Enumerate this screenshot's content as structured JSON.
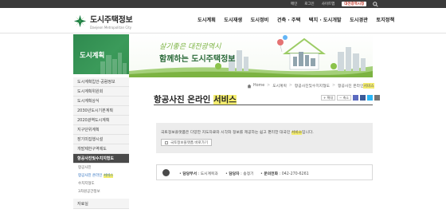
{
  "util": {
    "home": "메인",
    "login": "로그인",
    "sitemap": "사이트맵",
    "lang": "대전광역시청"
  },
  "logo": {
    "title": "도시주택정보",
    "subtitle": "Daejeon Metropolitan City"
  },
  "gnb": [
    "도시계획",
    "도시재생",
    "도시정비",
    "건축 · 주택",
    "택지 · 도시개발",
    "도시경관",
    "토지정책"
  ],
  "side_title": "도시계획",
  "banner": {
    "slogan1": "살기좋은 대전광역시",
    "slogan2": "함께하는 도시주택정보"
  },
  "lnb": {
    "items": [
      "도시계획입안·공람정보",
      "도시계획위원회",
      "도시계획상식",
      "2030년도시기본계획",
      "2020광역도시계획",
      "지구단위계획",
      "장기미집행시설",
      "개발제한구역제도",
      "항공사진및수치지형도"
    ],
    "subs": [
      "항공사진",
      "항공사진 온라인 ",
      "수치지형도",
      "3차원공간정보"
    ],
    "sub_hl": "서비스",
    "end": "자료실"
  },
  "breadcrumb": [
    "Home",
    "도시계획",
    "항공사진및수치지형도",
    "항공사진 온라인 ",
    "서비스"
  ],
  "page_title": {
    "text": "항공사진 온라인 ",
    "hl": "서비스"
  },
  "tools": {
    "enlarge": "확대",
    "reduce": "축소"
  },
  "notice": {
    "text": "국토정보플랫폼은 다양한 지도자료와 시각화 정보를 제공하는 쉽고 편리한 대국민 ",
    "text_hl": "서비스",
    "text_end": "입니다.",
    "button": "국토정보플랫폼 바로가기"
  },
  "dept": {
    "dept_label": "담당부서",
    "dept_value": "도시계획과",
    "person_label": "담당자",
    "person_value": "송정기",
    "phone_label": "문의전화",
    "phone_value": "042-270-6261"
  },
  "colors": {
    "green": "#3b9a5a",
    "dark": "#3a3a3a",
    "highlight": "#f3ec6d"
  }
}
